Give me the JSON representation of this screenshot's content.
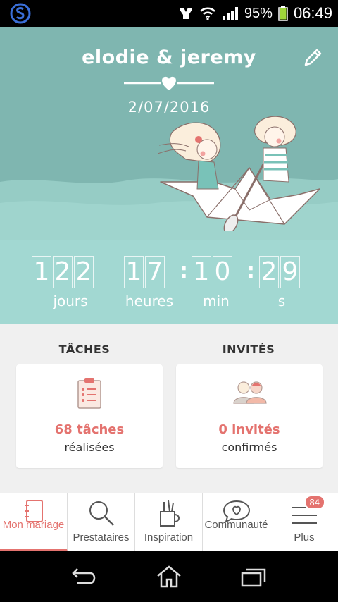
{
  "status": {
    "battery": "95%",
    "time": "06:49"
  },
  "header": {
    "title": "elodie & jeremy",
    "date": "2/07/2016"
  },
  "countdown": {
    "days": [
      "1",
      "2",
      "2"
    ],
    "hours": [
      "1",
      "7"
    ],
    "minutes": [
      "1",
      "0"
    ],
    "seconds": [
      "2",
      "9"
    ],
    "labels": {
      "days": "jours",
      "hours": "heures",
      "minutes": "min",
      "seconds": "s"
    }
  },
  "summary": {
    "tasks": {
      "heading": "TÂCHES",
      "count": "68 tâches",
      "sub": "réalisées"
    },
    "guests": {
      "heading": "INVITÉS",
      "count": "0 invités",
      "sub": "confirmés"
    }
  },
  "tabs": [
    {
      "label": "Mon mariage",
      "icon": "notebook-icon"
    },
    {
      "label": "Prestataires",
      "icon": "search-icon"
    },
    {
      "label": "Inspiration",
      "icon": "pencil-cup-icon"
    },
    {
      "label": "Communauté",
      "icon": "chat-heart-icon"
    },
    {
      "label": "Plus",
      "icon": "menu-icon",
      "badge": "84"
    }
  ],
  "colors": {
    "accent": "#e4736f",
    "teal": "#7fb6b0",
    "teal_light": "#a2d8d2"
  }
}
